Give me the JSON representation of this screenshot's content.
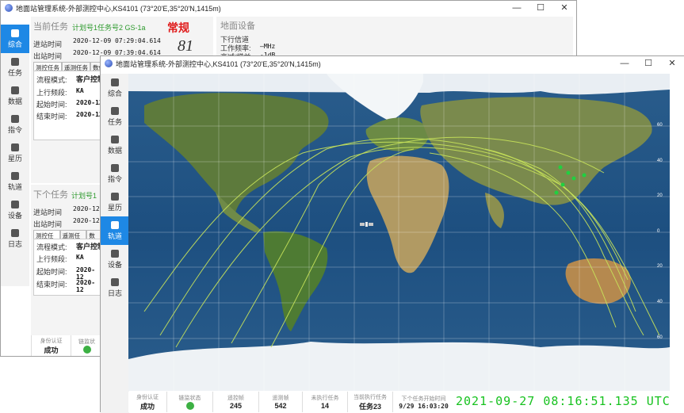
{
  "back_window": {
    "title": "地面站管理系统-外部测控中心,KS4101 (73°20'E,35°20'N,1415m)",
    "nav": [
      {
        "label": "综合",
        "icon": "home-icon"
      },
      {
        "label": "任务",
        "icon": "calendar-icon"
      },
      {
        "label": "数据",
        "icon": "download-icon"
      },
      {
        "label": "指令",
        "icon": "upload-icon"
      },
      {
        "label": "星历",
        "icon": "ephemeris-icon"
      },
      {
        "label": "轨道",
        "icon": "image-icon"
      },
      {
        "label": "设备",
        "icon": "device-icon"
      },
      {
        "label": "日志",
        "icon": "log-icon"
      }
    ],
    "current_task": {
      "heading": "当前任务",
      "plan": "计划号1任务号2 GS-1a",
      "mode_badge": "常规",
      "countdown": "81",
      "in_label": "进站时间",
      "in_value": "2020-12-09 07:29:04.614",
      "out_label": "出站时间",
      "out_value": "2020-12-09 07:39:04.614",
      "tabs": [
        "测控任务",
        "遥测任务",
        "数传"
      ],
      "rows": [
        {
          "label": "流程模式:",
          "value": "客户控制"
        },
        {
          "label": "上行频段:",
          "value": "KA"
        },
        {
          "label": "起始时间:",
          "value": "2020-12"
        },
        {
          "label": "结束时间:",
          "value": "2020-12"
        }
      ]
    },
    "ground_equipment": {
      "heading": "地面设备",
      "rows": [
        {
          "label": "下行信道",
          "value": ""
        },
        {
          "label": "工作频率:",
          "value": "—MHz"
        },
        {
          "label": "衰减/增益:",
          "value": "-1dB"
        }
      ]
    },
    "next_task": {
      "heading": "下个任务",
      "plan": "计划号1",
      "in_label": "进站时间",
      "in_value": "2020-12",
      "out_label": "出站时间",
      "out_value": "2020-12",
      "tabs": [
        "测控任务",
        "遥测任务",
        "数传"
      ],
      "rows": [
        {
          "label": "流程模式:",
          "value": "客户控制"
        },
        {
          "label": "上行频段:",
          "value": "KA"
        },
        {
          "label": "起始时间:",
          "value": "2020-12"
        },
        {
          "label": "结束时间:",
          "value": "2020-12"
        }
      ]
    },
    "status": [
      {
        "label": "身份认证",
        "value": "成功"
      },
      {
        "label": "链监状",
        "value": ""
      }
    ]
  },
  "front_window": {
    "title": "地面站管理系统-外部测控中心,KS4101 (73°20'E,35°20'N,1415m)",
    "nav": [
      {
        "label": "综合",
        "icon": "home-icon"
      },
      {
        "label": "任务",
        "icon": "calendar-icon"
      },
      {
        "label": "数据",
        "icon": "download-icon"
      },
      {
        "label": "指令",
        "icon": "upload-icon"
      },
      {
        "label": "星历",
        "icon": "ephemeris-icon"
      },
      {
        "label": "轨道",
        "icon": "image-icon"
      },
      {
        "label": "设备",
        "icon": "device-icon"
      },
      {
        "label": "日志",
        "icon": "log-icon"
      }
    ],
    "active_nav": 5,
    "lat_ticks": [
      "60",
      "40",
      "20",
      "0",
      "20",
      "40",
      "60"
    ],
    "status_cells": [
      {
        "label": "身份认证",
        "value": "成功"
      },
      {
        "label": "链监状态",
        "value": ""
      },
      {
        "label": "遥控帧",
        "value": "245"
      },
      {
        "label": "遥测帧",
        "value": "542"
      },
      {
        "label": "未执行任务",
        "value": "14"
      },
      {
        "label": "当前执行任务",
        "value": "任务23"
      },
      {
        "label": "下个任务开始时间",
        "value": "9/29 16:03:20"
      }
    ],
    "clock": "2021-09-27 08:16:51.135 UTC",
    "colors": {
      "accent": "#1e88e5",
      "track": "#c8e35a",
      "clock": "#17c21f",
      "ok_led": "#3cb043"
    }
  }
}
